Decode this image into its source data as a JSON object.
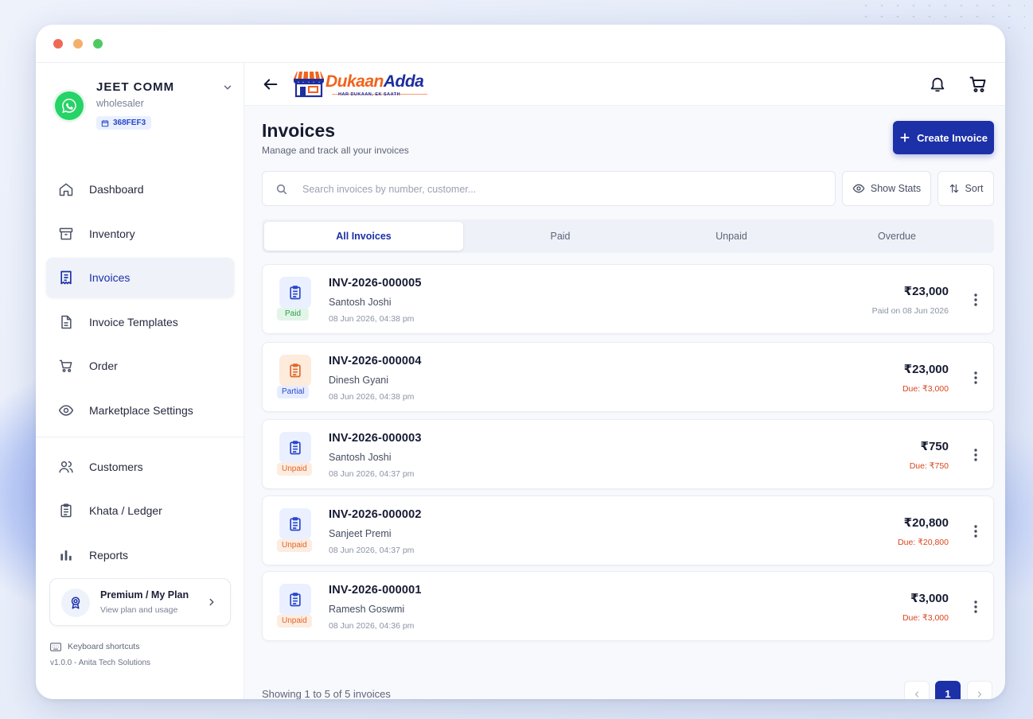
{
  "profile": {
    "name": "JEET COMM",
    "role": "wholesaler",
    "code": "368FEF3"
  },
  "sidebar": {
    "items": [
      {
        "label": "Dashboard",
        "icon": "home-icon"
      },
      {
        "label": "Inventory",
        "icon": "archive-box-icon"
      },
      {
        "label": "Invoices",
        "icon": "receipt-icon",
        "active": true
      },
      {
        "label": "Invoice Templates",
        "icon": "document-icon"
      },
      {
        "label": "Order",
        "icon": "cart-icon"
      },
      {
        "label": "Marketplace Settings",
        "icon": "eye-icon"
      }
    ],
    "items2": [
      {
        "label": "Customers",
        "icon": "users-icon"
      },
      {
        "label": "Khata / Ledger",
        "icon": "clipboard-icon"
      },
      {
        "label": "Reports",
        "icon": "bar-chart-icon"
      }
    ],
    "plan": {
      "title": "Premium / My Plan",
      "subtitle": "View plan and usage"
    },
    "shortcuts": "Keyboard shortcuts",
    "version": "v1.0.0 - Anita Tech Solutions"
  },
  "header": {
    "logo_dukaan": "Dukaan",
    "logo_adda": "Adda",
    "logo_tagline": "HAR DUKAAN, EK SAATH"
  },
  "page": {
    "title": "Invoices",
    "subtitle": "Manage and track all your invoices",
    "create_label": "Create Invoice"
  },
  "search": {
    "placeholder": "Search invoices by number, customer...",
    "value": ""
  },
  "toolbar": {
    "stats_label": "Show Stats",
    "sort_label": "Sort"
  },
  "tabs": [
    "All Invoices",
    "Paid",
    "Unpaid",
    "Overdue"
  ],
  "invoices": [
    {
      "number": "INV-2026-000005",
      "customer": "Santosh Joshi",
      "date": "08 Jun 2026, 04:38 pm",
      "amount": "₹23,000",
      "status_text": "Paid on 08 Jun 2026",
      "badge": "Paid",
      "kind": "paid"
    },
    {
      "number": "INV-2026-000004",
      "customer": "Dinesh Gyani",
      "date": "08 Jun 2026, 04:38 pm",
      "amount": "₹23,000",
      "status_text": "Due: ₹3,000",
      "badge": "Partial",
      "kind": "partial"
    },
    {
      "number": "INV-2026-000003",
      "customer": "Santosh Joshi",
      "date": "08 Jun 2026, 04:37 pm",
      "amount": "₹750",
      "status_text": "Due: ₹750",
      "badge": "Unpaid",
      "kind": "unpaid"
    },
    {
      "number": "INV-2026-000002",
      "customer": "Sanjeet Premi",
      "date": "08 Jun 2026, 04:37 pm",
      "amount": "₹20,800",
      "status_text": "Due: ₹20,800",
      "badge": "Unpaid",
      "kind": "unpaid"
    },
    {
      "number": "INV-2026-000001",
      "customer": "Ramesh Goswmi",
      "date": "08 Jun 2026, 04:36 pm",
      "amount": "₹3,000",
      "status_text": "Due: ₹3,000",
      "badge": "Unpaid",
      "kind": "unpaid"
    }
  ],
  "footer": {
    "showing": "Showing 1 to 5 of 5 invoices",
    "current_page": "1"
  },
  "colors": {
    "accent": "#1c30a8",
    "paid": "#2e9e4f",
    "partial": "#2a47c9",
    "unpaid": "#e0662a",
    "due": "#d9451c"
  }
}
